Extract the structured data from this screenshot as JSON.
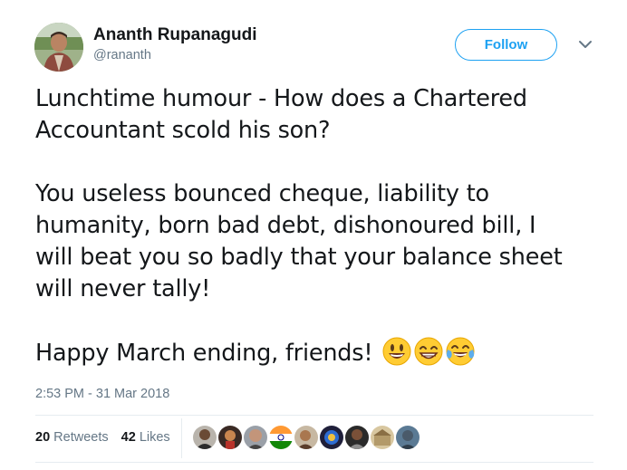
{
  "user": {
    "display_name": "Ananth Rupanagudi",
    "handle": "@rananth"
  },
  "actions": {
    "follow_label": "Follow",
    "caret_icon": "chevron-down-icon"
  },
  "tweet": {
    "lines": [
      "Lunchtime humour - How does a Chartered",
      "Accountant scold his son?",
      "",
      "You useless bounced cheque, liability to",
      "humanity, born bad debt, dishonoured bill, I",
      "will beat you so badly that your balance sheet",
      "will never tally!",
      "",
      "Happy March ending, friends!"
    ],
    "emojis": [
      "smiley-emoji",
      "grinning-emoji",
      "tears-of-joy-emoji"
    ],
    "timestamp": "2:53 PM - 31 Mar 2018"
  },
  "stats": {
    "retweets_count": "20",
    "retweets_label": "Retweets",
    "likes_count": "42",
    "likes_label": "Likes"
  },
  "colors": {
    "accent": "#1da1f2",
    "text": "#14171a",
    "secondary": "#657786",
    "divider": "#e6ecf0"
  }
}
